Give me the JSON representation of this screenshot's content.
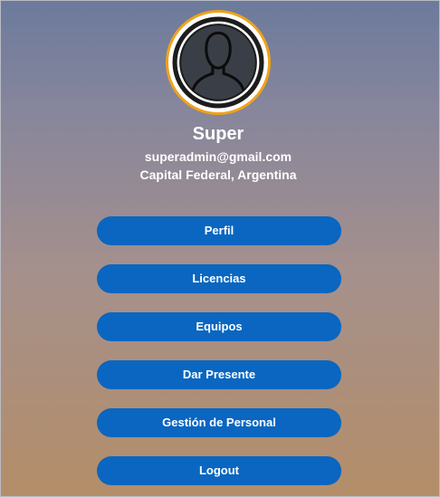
{
  "profile": {
    "avatar_icon": "user-silhouette-icon",
    "avatar_ring_color": "#f0a21a",
    "name": "Super",
    "email": "superadmin@gmail.com",
    "location": "Capital Federal, Argentina"
  },
  "menu": {
    "button_color": "#0a66c0",
    "items": [
      {
        "label": "Perfil"
      },
      {
        "label": "Licencias"
      },
      {
        "label": "Equipos"
      },
      {
        "label": "Dar Presente"
      },
      {
        "label": "Gestión de Personal"
      },
      {
        "label": "Logout"
      }
    ]
  }
}
